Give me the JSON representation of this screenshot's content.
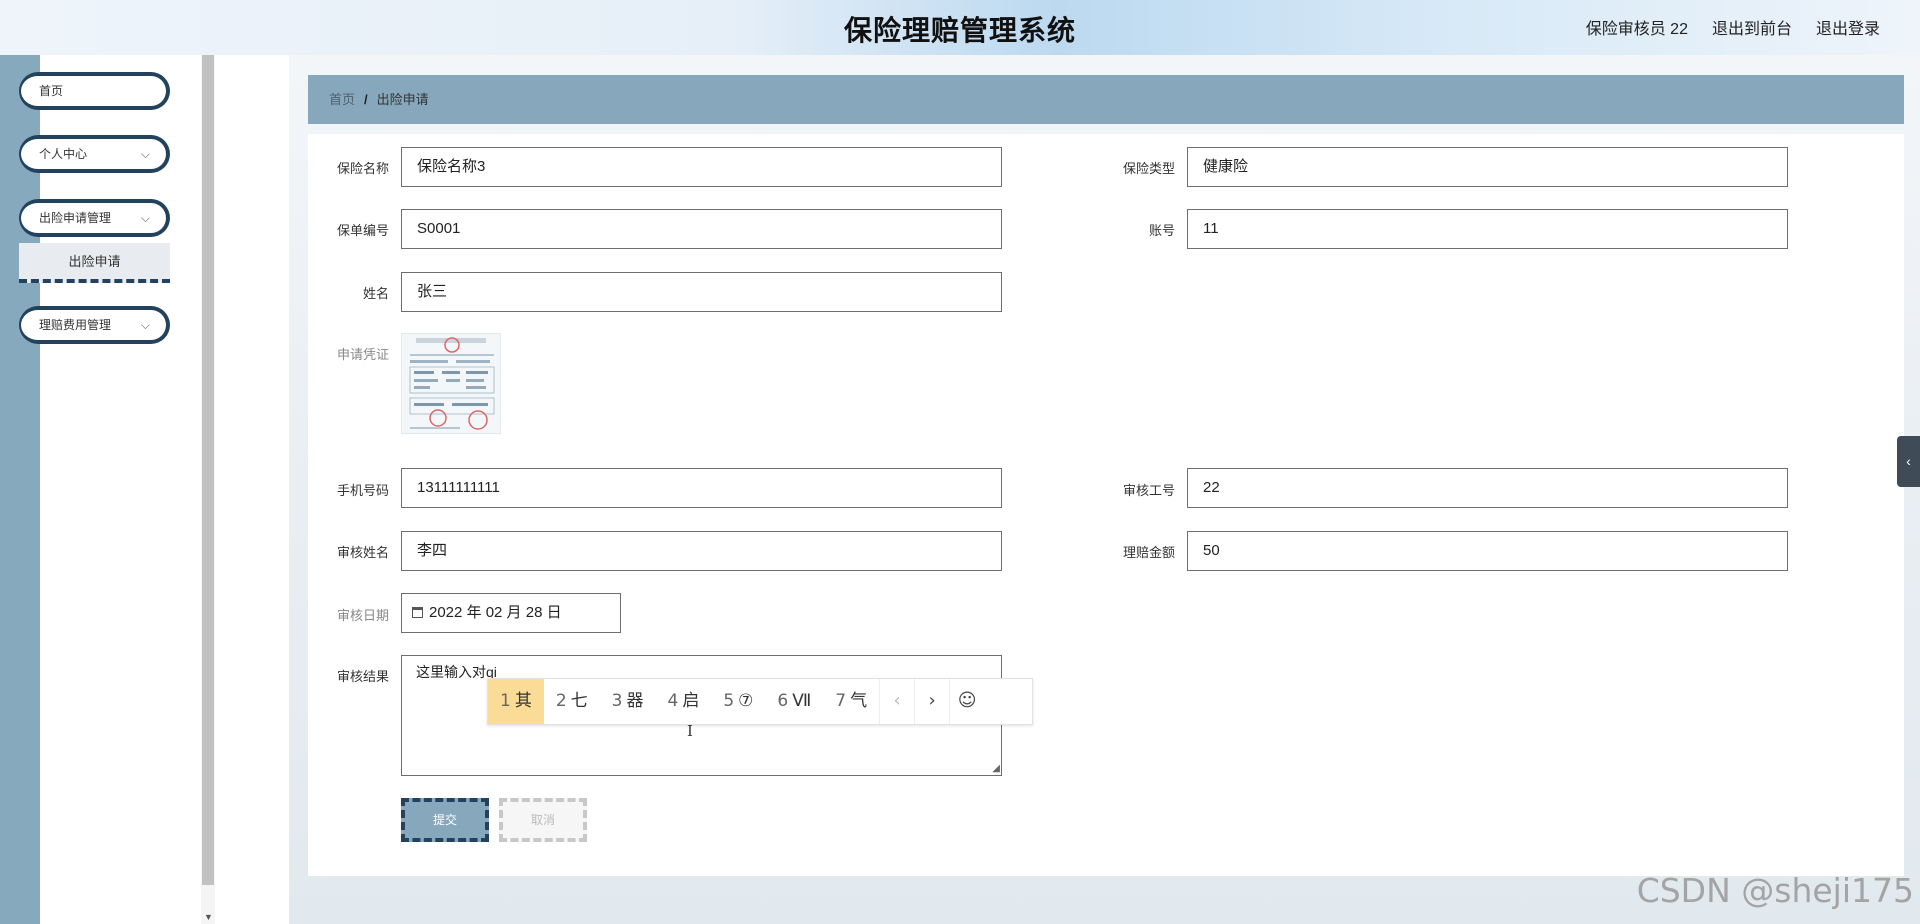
{
  "app": {
    "title": "保险理赔管理系统",
    "user_label": "保险审核员 22",
    "back_to_front": "退出到前台",
    "logout": "退出登录"
  },
  "sidebar": {
    "items": [
      {
        "label": "首页",
        "has_chevron": false
      },
      {
        "label": "个人中心",
        "has_chevron": true
      },
      {
        "label": "出险申请管理",
        "has_chevron": true,
        "sub": "出险申请"
      },
      {
        "label": "理赔费用管理",
        "has_chevron": true
      }
    ],
    "chevron": "⌵"
  },
  "breadcrumb": {
    "home": "首页",
    "separator": "/",
    "current": "出险申请"
  },
  "form": {
    "insurance_name": {
      "label": "保险名称",
      "value": "保险名称3"
    },
    "insurance_type": {
      "label": "保险类型",
      "value": "健康险"
    },
    "policy_no": {
      "label": "保单编号",
      "value": "S0001"
    },
    "account": {
      "label": "账号",
      "value": "11"
    },
    "name": {
      "label": "姓名",
      "value": "张三"
    },
    "voucher": {
      "label": "申请凭证"
    },
    "phone": {
      "label": "手机号码",
      "value": "13111111111"
    },
    "reviewer_id": {
      "label": "审核工号",
      "value": "22"
    },
    "reviewer_name": {
      "label": "审核姓名",
      "value": "李四"
    },
    "claim_amount": {
      "label": "理赔金额",
      "value": "50"
    },
    "review_date": {
      "label": "审核日期",
      "value": "2022 年 02 月 28 日"
    },
    "review_result": {
      "label": "审核结果",
      "value": "这里输入对qi"
    },
    "submit": "提交",
    "cancel": "取消"
  },
  "ime": {
    "candidates": [
      {
        "n": "1",
        "text": "其",
        "selected": true
      },
      {
        "n": "2",
        "text": "七"
      },
      {
        "n": "3",
        "text": "器"
      },
      {
        "n": "4",
        "text": "启"
      },
      {
        "n": "5",
        "text": "⑦"
      },
      {
        "n": "6",
        "text": "Ⅶ"
      },
      {
        "n": "7",
        "text": "气"
      }
    ],
    "prev": "‹",
    "next": "›",
    "emoji": "☺"
  },
  "side_tab": "‹",
  "watermark": "CSDN @sheji175",
  "colors": {
    "accent": "#87a8bc",
    "dark": "#23425d",
    "ime_selected": "#fbdc97"
  }
}
